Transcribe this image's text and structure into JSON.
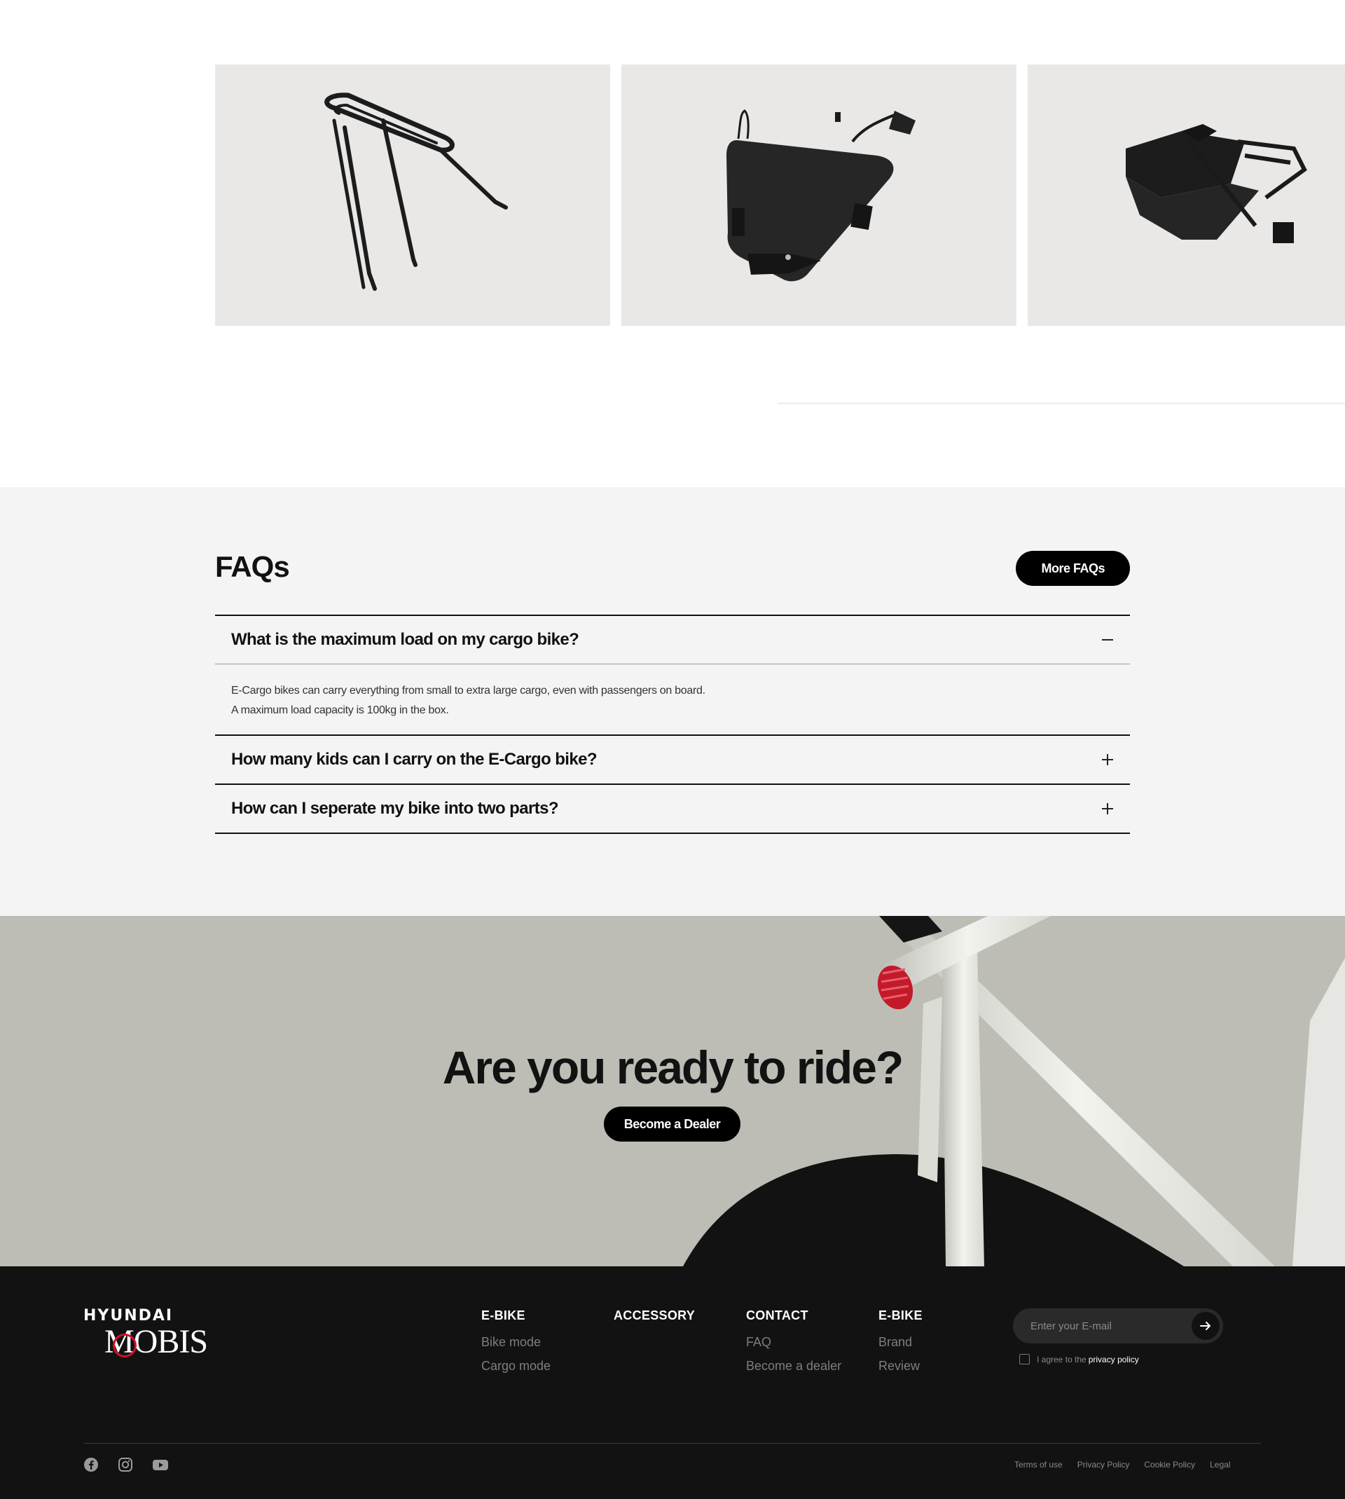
{
  "accessories": [
    {
      "name": "rear-rack"
    },
    {
      "name": "frame-bag"
    },
    {
      "name": "front-basket"
    }
  ],
  "faq": {
    "title": "FAQs",
    "more_label": "More FAQs",
    "items": [
      {
        "question": "What is the maximum load on my cargo bike?",
        "expanded": true,
        "answer_line1": "E-Cargo bikes can carry everything from small to extra large cargo, even with passengers on board.",
        "answer_line2": "A maximum load capacity is 100kg in the box."
      },
      {
        "question": "How many kids can I carry on the E-Cargo bike?",
        "expanded": false
      },
      {
        "question": "How can I seperate my bike into two parts?",
        "expanded": false
      }
    ]
  },
  "cta": {
    "title": "Are you ready to ride?",
    "button_label": "Become a Dealer"
  },
  "footer": {
    "logo_top": "HYUNDAI",
    "logo_bottom": "MOBIS",
    "columns": [
      {
        "heading": "E-BIKE",
        "links": [
          "Bike mode",
          "Cargo mode"
        ]
      },
      {
        "heading": "ACCESSORY",
        "links": []
      },
      {
        "heading": "CONTACT",
        "links": [
          "FAQ",
          "Become a dealer"
        ]
      },
      {
        "heading": "E-BIKE",
        "links": [
          "Brand",
          "Review"
        ]
      }
    ],
    "newsletter_placeholder": "Enter your E-mail",
    "agree_text": "I agree to the",
    "privacy_link": "privacy policy",
    "legal": [
      "Terms of use",
      "Privacy Policy",
      "Cookie Policy",
      "Legal"
    ],
    "socials": [
      "facebook-icon",
      "instagram-icon",
      "youtube-icon"
    ]
  },
  "colors": {
    "accent_red": "#d3102a",
    "footer_bg": "#121212",
    "faq_bg": "#f4f4f4",
    "cta_bg": "#bdbdb6"
  }
}
